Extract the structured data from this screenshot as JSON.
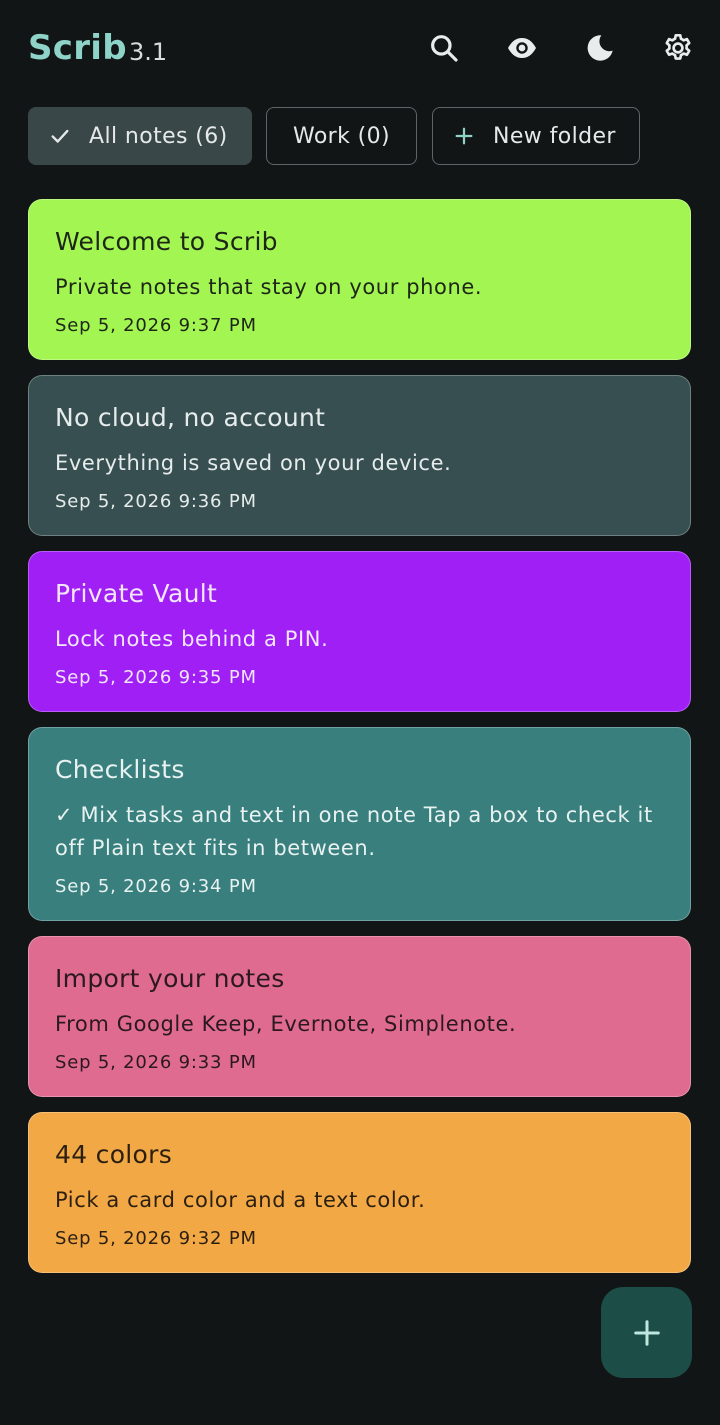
{
  "app": {
    "title": "Scrib",
    "version": "3.1",
    "accent": "#8ed3c8"
  },
  "header_icons": [
    "search-icon",
    "eye-icon",
    "moon-icon",
    "gear-icon"
  ],
  "chips": [
    {
      "label": "All notes (6)",
      "selected": true,
      "icon": "check-icon"
    },
    {
      "label": "Work (0)",
      "selected": false
    },
    {
      "label": "New folder",
      "selected": false,
      "icon": "plus-icon"
    }
  ],
  "notes": [
    {
      "title": "Welcome to Scrib",
      "body": "Private notes that stay on your phone.",
      "date": "Sep 5, 2026 9:37 PM",
      "bg": "#a3f552",
      "fg": "#1d2617"
    },
    {
      "title": "No cloud, no account",
      "body": "Everything is saved on your device.",
      "date": "Sep 5, 2026 9:36 PM",
      "bg": "#374f50",
      "fg": "#e6ecec"
    },
    {
      "title": "Private Vault",
      "body": "Lock notes behind a PIN.",
      "date": "Sep 5, 2026 9:35 PM",
      "bg": "#a01ff5",
      "fg": "#f2e6fb"
    },
    {
      "title": "Checklists",
      "body": "✓ Mix tasks and text in one note Tap a box to check it off Plain text fits in between.",
      "date": "Sep 5, 2026 9:34 PM",
      "bg": "#397f7d",
      "fg": "#e8f2f1"
    },
    {
      "title": "Import your notes",
      "body": "From Google Keep, Evernote, Simplenote.",
      "date": "Sep 5, 2026 9:33 PM",
      "bg": "#e06b91",
      "fg": "#2b1820"
    },
    {
      "title": "44 colors",
      "body": "Pick a card color and a text color.",
      "date": "Sep 5, 2026 9:32 PM",
      "bg": "#f3a846",
      "fg": "#2b1f10"
    }
  ],
  "fab": {
    "icon": "plus-icon",
    "label": "+"
  }
}
